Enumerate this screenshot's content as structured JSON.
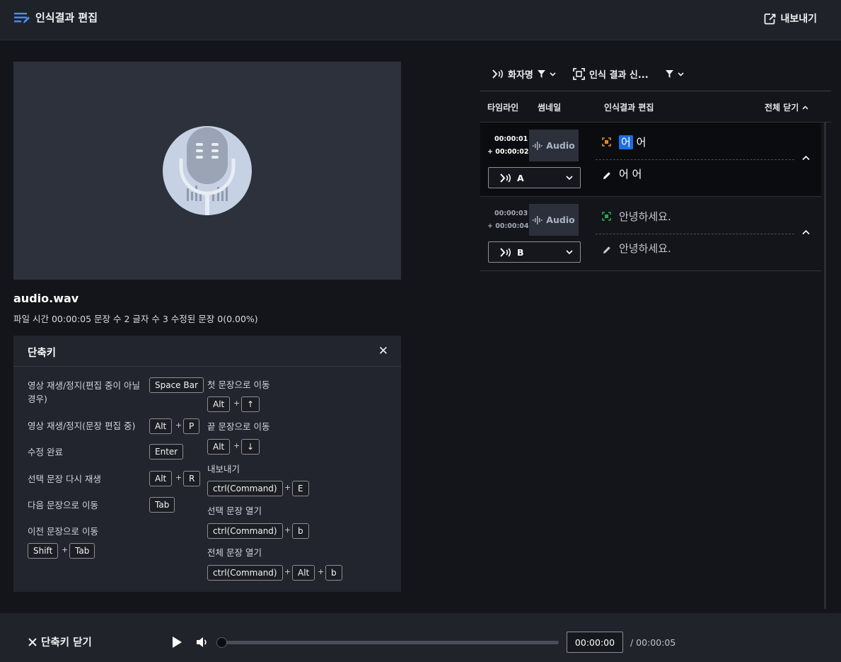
{
  "header": {
    "title": "인식결과 편집",
    "export_label": "내보내기"
  },
  "file": {
    "name": "audio.wav",
    "meta": "파일 시간 00:00:05 문장 수 2 글자 수 3 수정된 문장 0(0.00%)"
  },
  "shortcuts": {
    "title": "단축키",
    "left": [
      {
        "label": "영상 재생/정지(편집 중이 아닐 경우)",
        "keys": [
          "Space Bar"
        ]
      },
      {
        "label": "영상 재생/정지(문장 편집 중)",
        "keys": [
          "Alt",
          "P"
        ]
      },
      {
        "label": "수정 완료",
        "keys": [
          "Enter"
        ]
      },
      {
        "label": "선택 문장 다시 재생",
        "keys": [
          "Alt",
          "R"
        ]
      },
      {
        "label": "다음 문장으로 이동",
        "keys": [
          "Tab"
        ]
      },
      {
        "label": "이전 문장으로 이동",
        "keys": [
          "Shift",
          "Tab"
        ]
      }
    ],
    "right": [
      {
        "label": "첫 문장으로 이동",
        "keys": [
          "Alt",
          "↑"
        ]
      },
      {
        "label": "끝 문장으로 이동",
        "keys": [
          "Alt",
          "↓"
        ]
      },
      {
        "label": "내보내기",
        "keys": [
          "ctrl(Command)",
          "E"
        ]
      },
      {
        "label": "선택 문장 열기",
        "keys": [
          "ctrl(Command)",
          "b"
        ]
      },
      {
        "label": "전체 문장 열기",
        "keys": [
          "ctrl(Command)",
          "Alt",
          "b"
        ]
      }
    ],
    "plus": "+"
  },
  "filters": {
    "speaker": "화자명",
    "confidence": "인식 결과 신..."
  },
  "columns": {
    "timeline": "타임라인",
    "thumbnail": "썸네일",
    "edit": "인식결과 편집",
    "collapse_all": "전체 닫기"
  },
  "segments": [
    {
      "start": "00:00:01",
      "end": "+ 00:00:02",
      "thumb": "Audio",
      "speaker": "A",
      "orig_hl": "어",
      "orig_rest": " 어",
      "edited": "어 어",
      "conf_color": "#e08a1e"
    },
    {
      "start": "00:00:03",
      "end": "+ 00:00:04",
      "thumb": "Audio",
      "speaker": "B",
      "orig_hl": "",
      "orig_rest": "안녕하세요.",
      "edited": "안녕하세요.",
      "conf_color": "#2fa84f"
    }
  ],
  "player": {
    "close_shortcuts": "단축키 닫기",
    "current_time": "00:00:00",
    "total_time": "/ 00:00:05",
    "progress": 0
  },
  "colors": {
    "accent": "#1e6ee0",
    "header_icon": "#4a8df0"
  }
}
